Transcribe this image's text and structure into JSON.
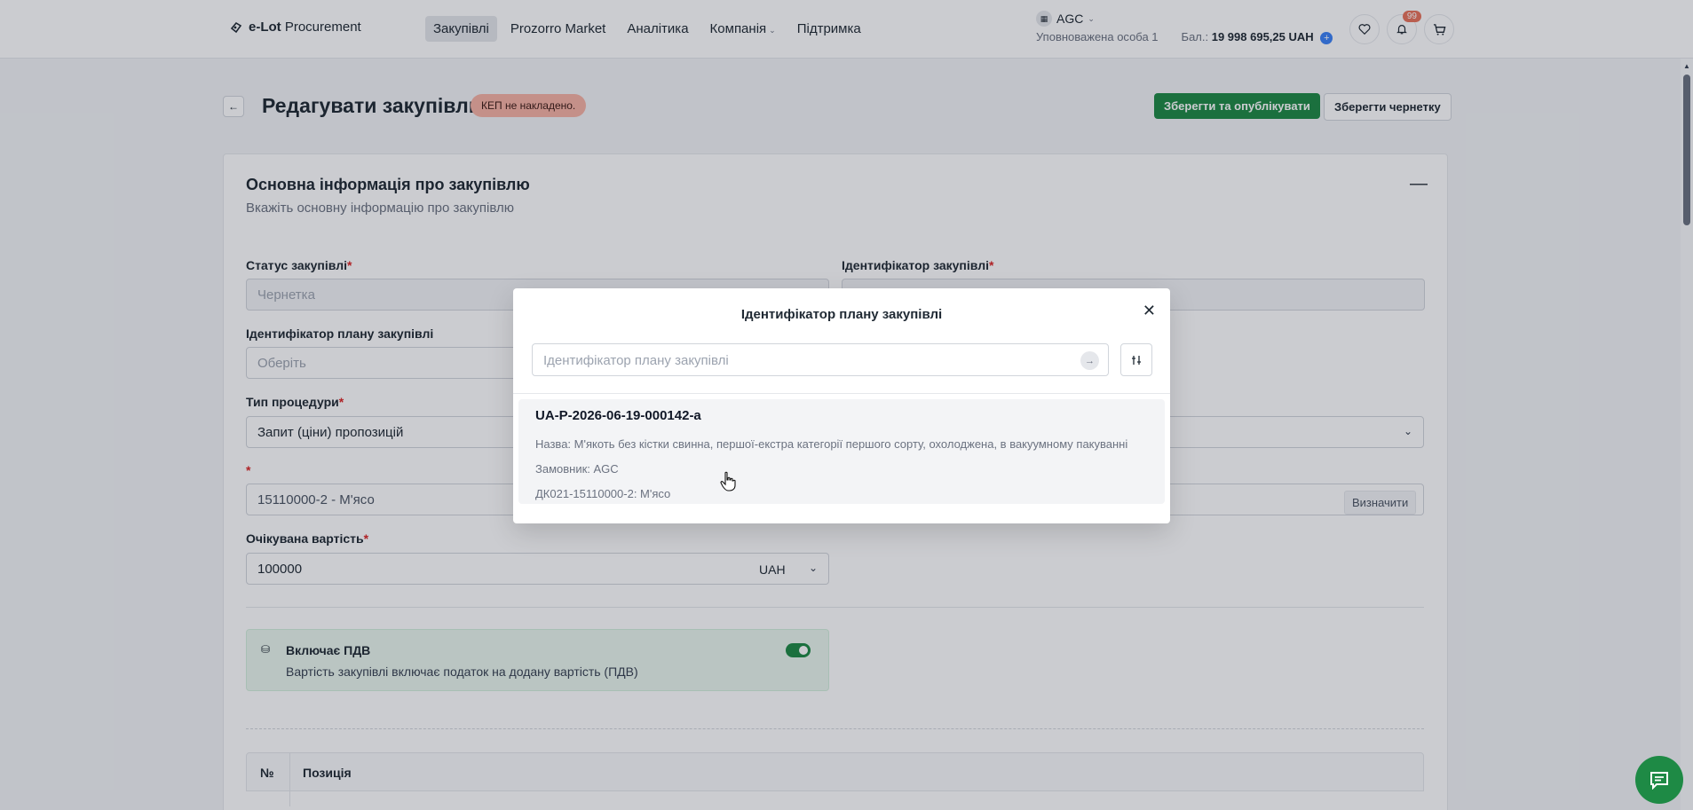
{
  "app": {
    "logo_bold": "e-Lot",
    "logo_rest": " Procurement"
  },
  "nav": {
    "items": [
      "Закупівлі",
      "Prozorro Market",
      "Аналітика",
      "Компанія",
      "Підтримка"
    ]
  },
  "account": {
    "org_name": "AGC",
    "role": "Уповноважена особа 1",
    "balance_label": "Бал.:",
    "balance_value": "19 998 695,25 UAH",
    "notifications_count": "99"
  },
  "page": {
    "title": "Редагувати закупівлю",
    "kep_badge": "КЕП не накладено.",
    "publish_button": "Зберегти та опублікувати",
    "draft_button": "Зберегти чернетку"
  },
  "section": {
    "title": "Основна інформація про закупівлю",
    "subtitle": "Вкажіть основну інформацію про закупівлю"
  },
  "form": {
    "status_label": "Статус закупівлі",
    "status_value": "Чернетка",
    "procurement_id_label": "Ідентифікатор закупівлі",
    "plan_id_label": "Ідентифікатор плану закупівлі",
    "plan_id_placeholder": "Оберіть",
    "procedure_label": "Тип процедури",
    "procedure_value": "Запит (ціни) пропозицій",
    "cpv_value": "15110000-2 - М'ясо",
    "define_button": "Визначити",
    "expected_value_label": "Очікувана вартість",
    "expected_value": "100000",
    "currency": "UAH",
    "required_mark": "*"
  },
  "vat": {
    "title": "Включає ПДВ",
    "description": "Вартість закупівлі включає податок на додану вартість (ПДВ)",
    "enabled": true
  },
  "table": {
    "col_num": "№",
    "col_position": "Позиція"
  },
  "modal": {
    "title": "Ідентифікатор плану закупівлі",
    "search_placeholder": "Ідентифікатор плану закупівлі",
    "result": {
      "id": "UA-P-2026-06-19-000142-a",
      "name": "Назва: М'якоть без кістки свинна, першої-екстра категорії першого сорту, охолоджена, в вакуумному пакуванні",
      "customer": "Замовник: AGC",
      "classifier": "ДК021-15110000-2: М'ясо"
    }
  },
  "colors": {
    "primary": "#1e8a45",
    "badge": "#f6b3a5",
    "notification": "#e8735a"
  }
}
